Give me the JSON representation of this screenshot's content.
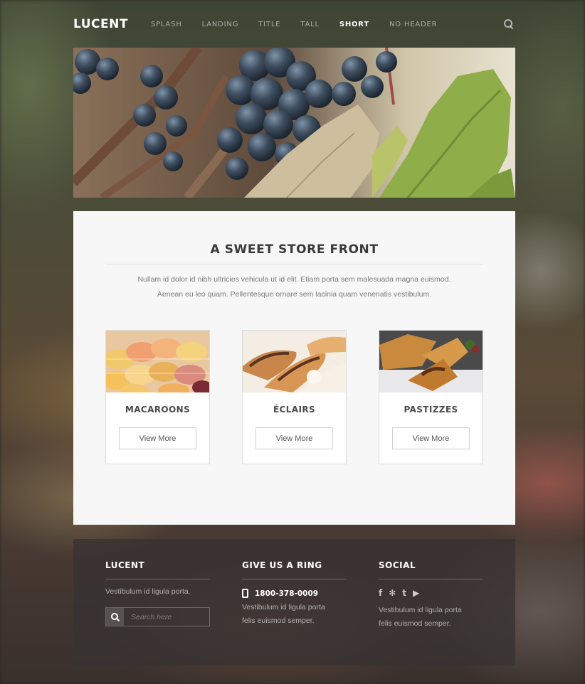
{
  "header": {
    "logo": "LUCENT",
    "nav": [
      "SPLASH",
      "LANDING",
      "TITLE",
      "TALL",
      "SHORT",
      "NO HEADER"
    ],
    "active_nav": "SHORT"
  },
  "main": {
    "title": "A SWEET STORE FRONT",
    "intro_line1": "Nullam id dolor id nibh ultricies vehicula ut id elit. Etiam porta sem malesuada magna euismod.",
    "intro_line2": "Aenean eu leo quam. Pellentesque ornare sem lacinia quam venenatis vestibulum.",
    "cards": [
      {
        "title": "MACAROONS",
        "button": "View More"
      },
      {
        "title": "ÉCLAIRS",
        "button": "View More"
      },
      {
        "title": "PASTIZZES",
        "button": "View More"
      }
    ]
  },
  "footer": {
    "col1": {
      "heading": "LUCENT",
      "text": "Vestibulum id ligula porta.",
      "search_placeholder": "Search here"
    },
    "col2": {
      "heading": "GIVE US A RING",
      "phone": "1800-378-0009",
      "text_line1": "Vestibulum id ligula porta",
      "text_line2": "felis euismod semper."
    },
    "col3": {
      "heading": "SOCIAL",
      "icons": [
        "facebook-icon",
        "yelp-icon",
        "twitter-icon",
        "youtube-icon"
      ],
      "icon_glyphs": [
        "f",
        "✻",
        "t",
        "▶"
      ],
      "text_line1": "Vestibulum id ligula porta",
      "text_line2": "felis euismod semper."
    }
  },
  "colors": {
    "panel_bg": "#f7f7f7",
    "footer_bg": "#373232",
    "accent_text": "#3a3a3a"
  }
}
